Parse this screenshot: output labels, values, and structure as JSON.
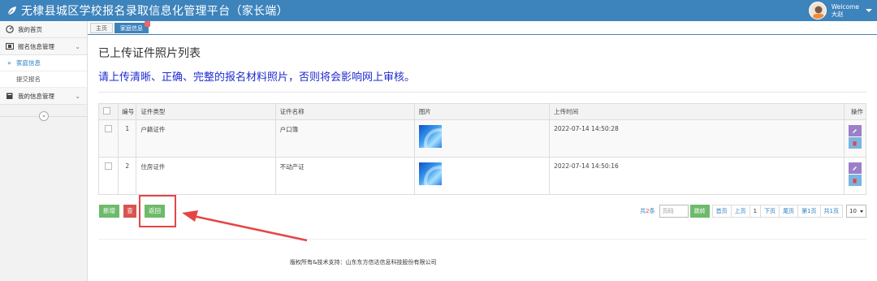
{
  "app": {
    "title": "无棣县城区学校报名录取信息化管理平台（家长端）"
  },
  "user": {
    "welcome": "Welcome",
    "name": "大赵"
  },
  "sidebar": {
    "items": [
      {
        "label": "我的首页"
      },
      {
        "label": "报名信息管理"
      },
      {
        "label": "我的信息管理"
      }
    ],
    "sub_items": [
      {
        "label": "家庭信息",
        "active": true
      },
      {
        "label": "提交报名",
        "active": false
      }
    ]
  },
  "tabs": [
    {
      "label": "主页"
    },
    {
      "label": "家庭信息"
    }
  ],
  "page": {
    "title": "已上传证件照片列表",
    "notice": "请上传清晰、正确、完整的报名材料照片，否则将会影响网上审核。"
  },
  "table": {
    "headers": [
      "编号",
      "证件类型",
      "证件名称",
      "图片",
      "上传时间",
      "操作"
    ],
    "rows": [
      {
        "no": "1",
        "type": "户籍证件",
        "name": "户口簿",
        "time": "2022-07-14 14:50:28"
      },
      {
        "no": "2",
        "type": "住房证件",
        "name": "不动产证",
        "time": "2022-07-14 14:50:16"
      }
    ]
  },
  "actions": {
    "add": "新增",
    "delete": "查",
    "back": "返回"
  },
  "pager": {
    "total_prefix": "共",
    "total_count": "2",
    "total_suffix": "条",
    "page_placeholder": "页码",
    "go": "跳转",
    "first": "首页",
    "prev": "上页",
    "current": "1",
    "next": "下页",
    "last": "尾页",
    "page_info": "第1页",
    "total_pages": "共1页",
    "page_size": "10"
  },
  "footer": {
    "text": "版权所有&技术支持：山东东方信达信息科技股份有限公司"
  },
  "colors": {
    "brand": "#3d83bc",
    "notice": "#1e2bd1",
    "success": "#6dbb6a",
    "danger": "#d9534f",
    "annotation": "#e64545"
  }
}
